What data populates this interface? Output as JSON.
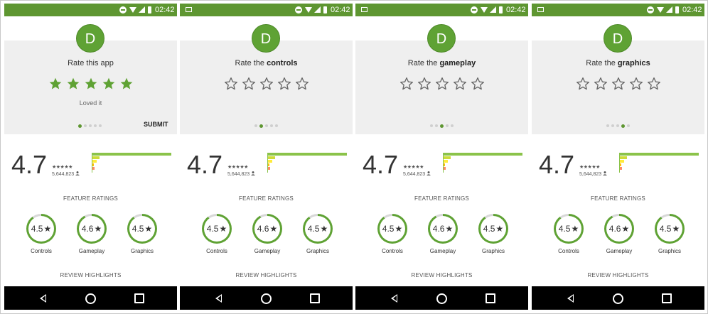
{
  "status_bar": {
    "time": "02:42"
  },
  "colors": {
    "status_bar": "#5e9631",
    "accent": "#5fa234",
    "star_filled": "#5fa234",
    "star_empty": "#666666",
    "navbar": "#000000"
  },
  "phones": [
    {
      "show_image_icon": false,
      "rate_prefix": "Rate this app",
      "rate_bold": "",
      "filled_stars": 5,
      "star_caption": "Loved it",
      "active_dot": 0,
      "show_submit": true
    },
    {
      "show_image_icon": true,
      "rate_prefix": "Rate the ",
      "rate_bold": "controls",
      "filled_stars": 0,
      "star_caption": "",
      "active_dot": 1,
      "show_submit": false
    },
    {
      "show_image_icon": true,
      "rate_prefix": "Rate the ",
      "rate_bold": "gameplay",
      "filled_stars": 0,
      "star_caption": "",
      "active_dot": 2,
      "show_submit": false
    },
    {
      "show_image_icon": true,
      "rate_prefix": "Rate the ",
      "rate_bold": "graphics",
      "filled_stars": 0,
      "star_caption": "",
      "active_dot": 3,
      "show_submit": false
    }
  ],
  "rate_card": {
    "avatar_letter": "D",
    "submit_label": "SUBMIT",
    "dot_count": 5
  },
  "summary": {
    "score": "4.7",
    "mini_stars": "★★★★★",
    "count": "5,644,823",
    "count_icon": "person-icon",
    "histogram": [
      {
        "stars": 5,
        "fraction": 1.0,
        "color": "#8bc34a"
      },
      {
        "stars": 4,
        "fraction": 0.1,
        "color": "#cddc39"
      },
      {
        "stars": 3,
        "fraction": 0.06,
        "color": "#ffeb3b"
      },
      {
        "stars": 2,
        "fraction": 0.03,
        "color": "#ffc107"
      },
      {
        "stars": 1,
        "fraction": 0.04,
        "color": "#ff8a65"
      }
    ]
  },
  "feature_ratings": {
    "title": "FEATURE RATINGS",
    "items": [
      {
        "score": "4.5",
        "label": "Controls",
        "fraction": 0.9
      },
      {
        "score": "4.6",
        "label": "Gameplay",
        "fraction": 0.92
      },
      {
        "score": "4.5",
        "label": "Graphics",
        "fraction": 0.9
      }
    ]
  },
  "review_highlights": {
    "title": "REVIEW HIGHLIGHTS"
  }
}
